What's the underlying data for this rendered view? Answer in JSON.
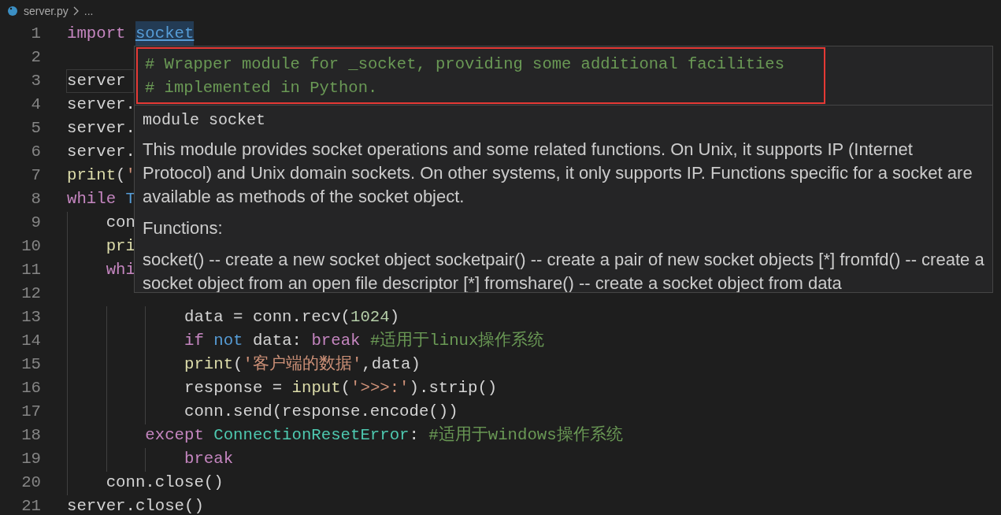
{
  "breadcrumb": {
    "file": "server.py",
    "rest": "..."
  },
  "lines": [
    {
      "number": "1",
      "tokens": [
        {
          "kind": "keyword",
          "text": "import "
        },
        {
          "kind": "link",
          "text": "socket"
        }
      ]
    },
    {
      "number": "2"
    },
    {
      "number": "3",
      "current": true,
      "tokens": [
        {
          "kind": "name",
          "text": "server "
        }
      ]
    },
    {
      "number": "4",
      "tokens": [
        {
          "kind": "name",
          "text": "server."
        }
      ]
    },
    {
      "number": "5",
      "tokens": [
        {
          "kind": "name",
          "text": "server."
        }
      ]
    },
    {
      "number": "6",
      "tokens": [
        {
          "kind": "name",
          "text": "server."
        }
      ]
    },
    {
      "number": "7",
      "tokens": [
        {
          "kind": "func",
          "text": "print"
        },
        {
          "kind": "name",
          "text": "("
        },
        {
          "kind": "string",
          "text": "'"
        }
      ]
    },
    {
      "number": "8",
      "tokens": [
        {
          "kind": "keyword",
          "text": "while "
        },
        {
          "kind": "const",
          "text": "T"
        }
      ]
    },
    {
      "number": "9",
      "tokens": [
        {
          "kind": "name",
          "text": "    con"
        }
      ]
    },
    {
      "number": "10",
      "tokens": [
        {
          "kind": "func",
          "text": "    pri"
        }
      ]
    },
    {
      "number": "11",
      "tokens": [
        {
          "kind": "keyword",
          "text": "    whi"
        }
      ]
    },
    {
      "number": "12"
    },
    {
      "number": "13",
      "tokens": [
        {
          "kind": "name",
          "text": "            data = conn.recv("
        },
        {
          "kind": "number",
          "text": "1024"
        },
        {
          "kind": "name",
          "text": ")"
        }
      ]
    },
    {
      "number": "14",
      "tokens": [
        {
          "kind": "keyword",
          "text": "            if "
        },
        {
          "kind": "const",
          "text": "not "
        },
        {
          "kind": "name",
          "text": "data: "
        },
        {
          "kind": "keyword",
          "text": "break "
        },
        {
          "kind": "comment",
          "text": "#适用于linux操作系统"
        }
      ]
    },
    {
      "number": "15",
      "tokens": [
        {
          "kind": "func",
          "text": "            print"
        },
        {
          "kind": "name",
          "text": "("
        },
        {
          "kind": "string",
          "text": "'客户端的数据'"
        },
        {
          "kind": "name",
          "text": ",data)"
        }
      ]
    },
    {
      "number": "16",
      "tokens": [
        {
          "kind": "name",
          "text": "            response = "
        },
        {
          "kind": "func",
          "text": "input"
        },
        {
          "kind": "name",
          "text": "("
        },
        {
          "kind": "string",
          "text": "'>>>:'"
        },
        {
          "kind": "name",
          "text": ").strip()"
        }
      ]
    },
    {
      "number": "17",
      "tokens": [
        {
          "kind": "name",
          "text": "            conn.send(response.encode())"
        }
      ]
    },
    {
      "number": "18",
      "tokens": [
        {
          "kind": "keyword",
          "text": "        except "
        },
        {
          "kind": "class",
          "text": "ConnectionResetError"
        },
        {
          "kind": "name",
          "text": ": "
        },
        {
          "kind": "comment",
          "text": "#适用于windows操作系统"
        }
      ]
    },
    {
      "number": "19",
      "tokens": [
        {
          "kind": "keyword",
          "text": "            break"
        }
      ]
    },
    {
      "number": "20",
      "tokens": [
        {
          "kind": "name",
          "text": "    conn.close()"
        }
      ]
    },
    {
      "number": "21",
      "tokens": [
        {
          "kind": "name",
          "text": "server.close()"
        }
      ]
    }
  ],
  "hover": {
    "source_comment": [
      "# Wrapper module for _socket, providing some additional facilities",
      "# implemented in Python."
    ],
    "signature": "module socket",
    "paragraphs": [
      "This module provides socket operations and some related functions. On Unix, it supports IP (Internet Protocol) and Unix domain sockets. On other systems, it only supports IP. Functions specific for a socket are available as methods of the socket object.",
      "Functions:",
      "socket() -- create a new socket object socketpair() -- create a pair of new socket objects [*] fromfd() -- create a socket object from an open file descriptor [*] fromshare() -- create a socket object from data"
    ]
  }
}
